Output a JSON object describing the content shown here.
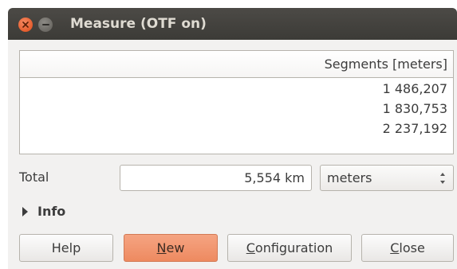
{
  "window": {
    "title": "Measure (OTF on)"
  },
  "table": {
    "header": "Segments [meters]",
    "rows": [
      "1 486,207",
      "1 830,753",
      "2 237,192"
    ]
  },
  "total": {
    "label": "Total",
    "value": "5,554 km",
    "unit_selected": "meters"
  },
  "info": {
    "label": "Info"
  },
  "buttons": {
    "help": "Help",
    "new_mnemonic": "N",
    "new_rest": "ew",
    "config_mnemonic": "C",
    "config_rest": "onfiguration",
    "close_mnemonic": "C",
    "close_rest": "lose"
  }
}
